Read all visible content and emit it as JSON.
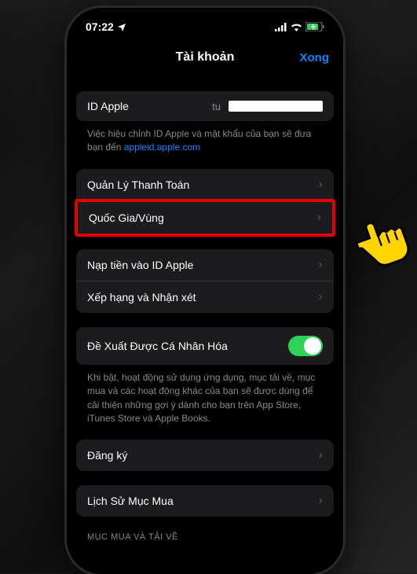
{
  "status": {
    "time": "07:22",
    "location_icon": "◀",
    "signal": "ııll",
    "wifi": "✓",
    "battery": "▸"
  },
  "nav": {
    "title": "Tài khoản",
    "done": "Xong"
  },
  "apple_id": {
    "label": "ID Apple",
    "value_prefix": "tu",
    "footer": "Việc hiệu chỉnh ID Apple và mật khẩu của bạn sẽ đưa bạn đến ",
    "link": "appleid.apple.com"
  },
  "rows": {
    "payment": "Quản Lý Thanh Toán",
    "country": "Quốc Gia/Vùng",
    "add_funds": "Nạp tiền vào ID Apple",
    "ratings": "Xếp hạng và Nhận xét",
    "personal_rec": "Đề Xuất Được Cá Nhân Hóa",
    "subscribe": "Đăng ký",
    "purchase_history": "Lịch Sử Mục Mua"
  },
  "personal_rec_footer": "Khi bật, hoạt động sử dụng ứng dụng, mục tải về, mục mua và các hoạt động khác của bạn sẽ được dùng để cải thiện những gợi ý dành cho bạn trên App Store, iTunes Store và Apple Books.",
  "section_header": "MỤC MUA VÀ TẢI VỀ"
}
